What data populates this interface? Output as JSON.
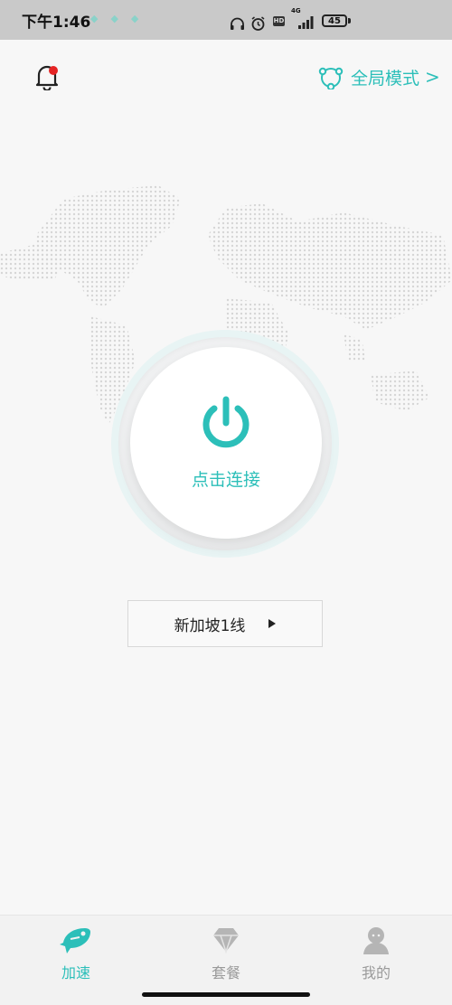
{
  "status_bar": {
    "time": "下午1:46",
    "network": "4G",
    "battery": "45"
  },
  "header": {
    "mode_label": "全局模式",
    "mode_chevron": ">",
    "icons": {
      "left": "bell-icon",
      "mode": "network-nodes-icon"
    }
  },
  "main": {
    "connect_label": "点击连接",
    "server_name": "新加坡1线",
    "power_icon": "power-icon"
  },
  "nav": {
    "items": [
      {
        "label": "加速",
        "icon": "rocket-fish-icon",
        "active": true
      },
      {
        "label": "套餐",
        "icon": "diamond-icon",
        "active": false
      },
      {
        "label": "我的",
        "icon": "user-icon",
        "active": false
      }
    ]
  },
  "colors": {
    "accent": "#2cbfb9",
    "inactive": "#9a9a9a",
    "notification_dot": "#e52424",
    "background": "#f7f7f7"
  }
}
